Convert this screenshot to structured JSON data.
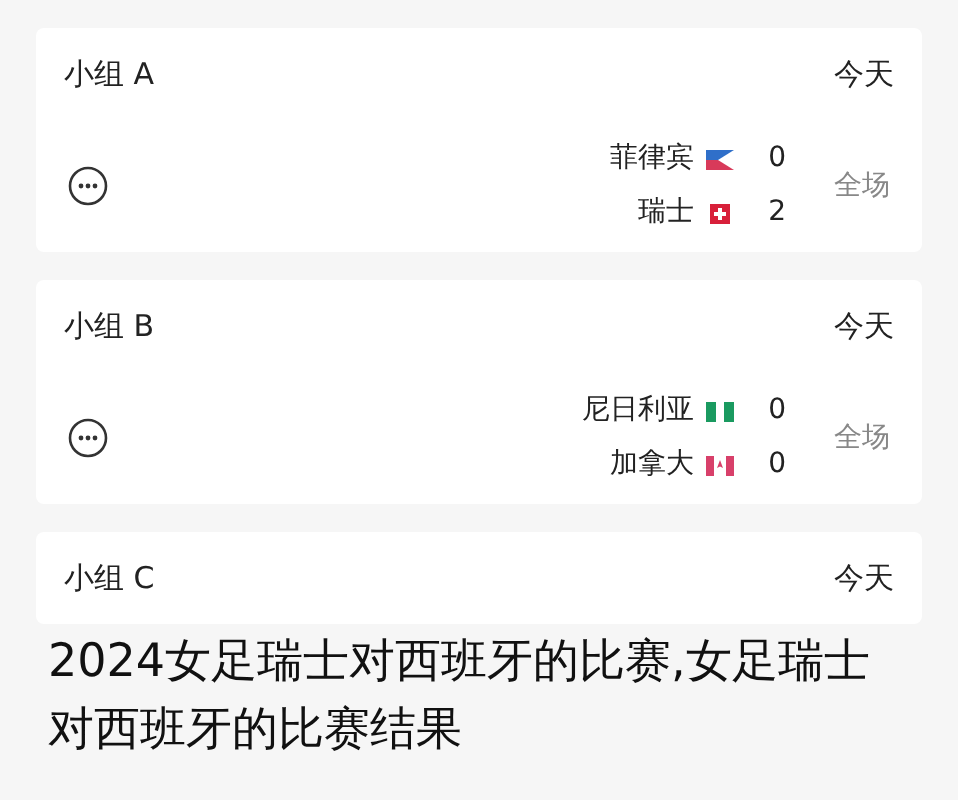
{
  "groups": [
    {
      "name": "小组 A",
      "day": "今天",
      "matches": [
        {
          "status": "全场",
          "teams": [
            {
              "name": "菲律宾",
              "score": "0",
              "kind": "ph"
            },
            {
              "name": "瑞士",
              "score": "2",
              "kind": "ch"
            }
          ]
        }
      ]
    },
    {
      "name": "小组 B",
      "day": "今天",
      "matches": [
        {
          "status": "全场",
          "teams": [
            {
              "name": "尼日利亚",
              "score": "0",
              "kind": "ng"
            },
            {
              "name": "加拿大",
              "score": "0",
              "kind": "ca"
            }
          ]
        }
      ]
    },
    {
      "name": "小组 C",
      "day": "今天"
    }
  ],
  "caption": "2024女足瑞士对西班牙的比赛,女足瑞士对西班牙的比赛结果"
}
